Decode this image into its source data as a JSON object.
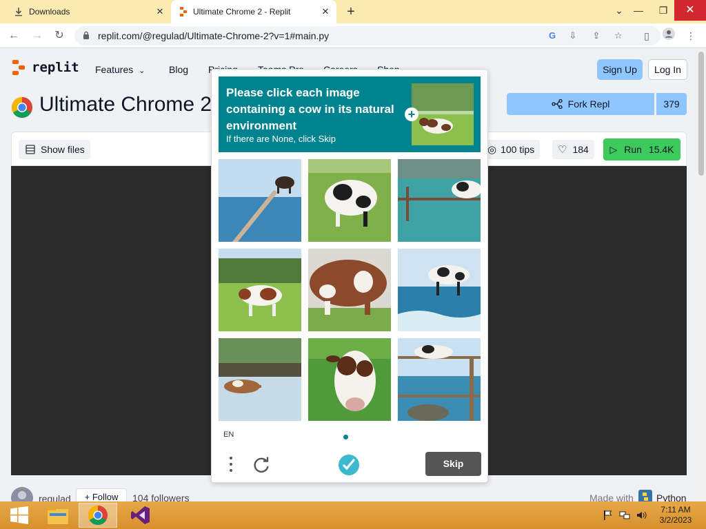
{
  "browser": {
    "tabs": [
      {
        "title": "Downloads",
        "active": false
      },
      {
        "title": "Ultimate Chrome 2 - Replit",
        "active": true
      }
    ],
    "url": "replit.com/@regulad/Ultimate-Chrome-2?v=1#main.py"
  },
  "site": {
    "logo_text": "replit",
    "nav": [
      "Features",
      "Blog",
      "Pricing",
      "Teams Pro",
      "Careers",
      "Shop"
    ],
    "sign_up": "Sign Up",
    "log_in": "Log In"
  },
  "repl": {
    "title": "Ultimate Chrome 2",
    "fork_label": "Fork Repl",
    "fork_count": "379",
    "show_files": "Show files",
    "tips": "100 tips",
    "likes": "184",
    "run_label": "Run",
    "run_count": "15.4K",
    "owner": "regulad",
    "follow_label": "Follow",
    "followers": "104 followers",
    "made_with": "Made with",
    "language": "Python"
  },
  "captcha": {
    "prompt": "Please click each image containing a cow in its natural environment",
    "subtext": "If there are None, click Skip",
    "language": "EN",
    "skip_label": "Skip",
    "images": [
      {
        "scene": "cow-jumping-over-water-bridge"
      },
      {
        "scene": "cow-grazing-field"
      },
      {
        "scene": "cow-standing-in-pool"
      },
      {
        "scene": "cow-in-meadow-forest"
      },
      {
        "scene": "cow-closeup-grass"
      },
      {
        "scene": "cow-flying-over-sea"
      },
      {
        "scene": "cow-swimming-lake"
      },
      {
        "scene": "cow-face-closeup"
      },
      {
        "scene": "cow-on-fence-sea"
      }
    ]
  },
  "taskbar": {
    "apps": [
      "start-icon",
      "file-explorer-icon",
      "chrome-icon",
      "visual-studio-icon"
    ],
    "time": "7:11 AM",
    "date": "3/2/2023"
  },
  "colors": {
    "captcha_teal": "#00838f",
    "replit_orange": "#f26207",
    "fork_blue": "#8ec7ff",
    "run_green": "#3ec95c",
    "taskbar": "#d8902d"
  }
}
